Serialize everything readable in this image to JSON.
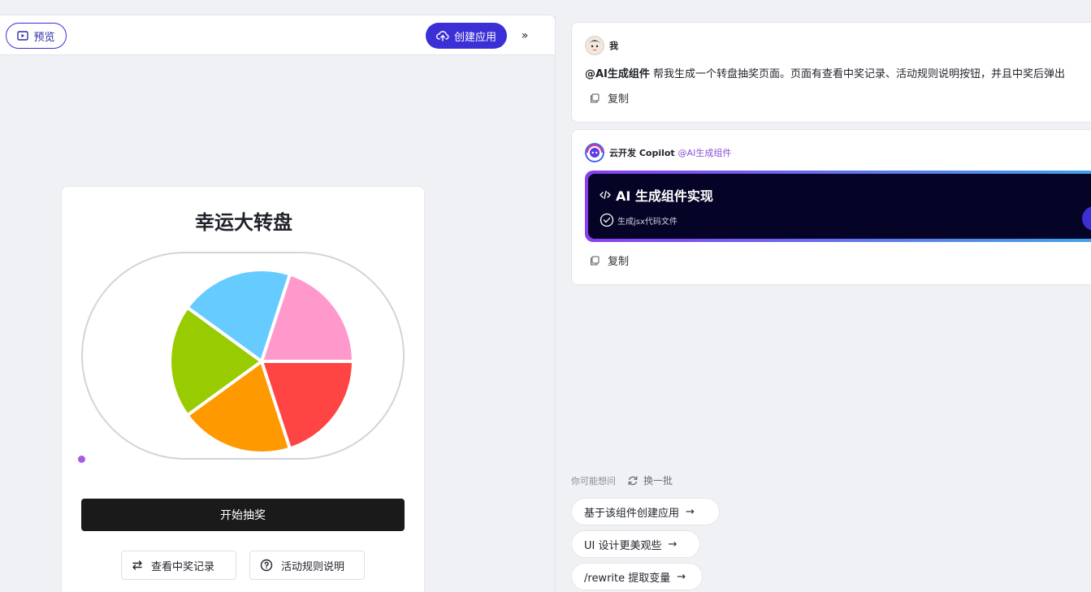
{
  "topbar": {
    "preview_label": "预览",
    "create_label": "创建应用",
    "expand_glyph": "»"
  },
  "wheel_card": {
    "title": "幸运大转盘",
    "start_label": "开始抽奖",
    "records_label": "查看中奖记录",
    "rules_label": "活动规则说明",
    "segment_colors": [
      "#ff99cc",
      "#66ccff",
      "#99cc00",
      "#ff9900",
      "#ff4444"
    ]
  },
  "chat": {
    "user": {
      "name": "我",
      "mention": "@AI生成组件",
      "text": " 帮我生成一个转盘抽奖页面。页面有查看中奖记录、活动规则说明按钮，并且中奖后弹出",
      "copy_label": "复制"
    },
    "bot": {
      "name": "云开发 Copilot",
      "mention": "@AI生成组件",
      "card_title": "AI 生成组件实现",
      "card_status": "生成jsx代码文件",
      "copy_label": "复制"
    }
  },
  "suggestions": {
    "label": "你可能想问",
    "refresh_label": "换一批",
    "items": [
      "基于该组件创建应用",
      "UI 设计更美观些",
      "/rewrite 提取变量"
    ]
  }
}
